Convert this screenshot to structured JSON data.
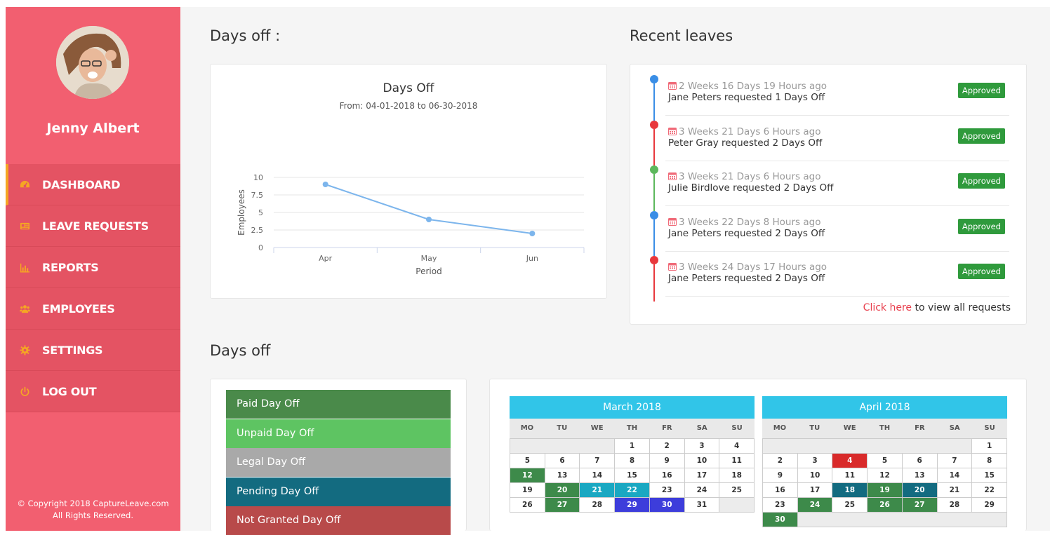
{
  "colors": {
    "sidebar": "#f25f70",
    "accent": "#f5a623",
    "approved": "#2f9a3c",
    "calendar_header": "#31c5e8",
    "chart_line": "#7cb5ec"
  },
  "sidebar": {
    "user_name": "Jenny Albert",
    "items": [
      {
        "label": "DASHBOARD",
        "icon": "dashboard-icon"
      },
      {
        "label": "LEAVE REQUESTS",
        "icon": "id-card-icon"
      },
      {
        "label": "REPORTS",
        "icon": "bar-chart-icon"
      },
      {
        "label": "EMPLOYEES",
        "icon": "users-icon"
      },
      {
        "label": "SETTINGS",
        "icon": "gear-icon"
      },
      {
        "label": "LOG OUT",
        "icon": "power-icon"
      }
    ],
    "copyright_line1": "© Copyright 2018 CaptureLeave.com",
    "copyright_line2": "All Rights Reserved."
  },
  "main": {
    "days_off_heading": "Days off :",
    "recent_heading": "Recent leaves",
    "days_off_heading2": "Days off"
  },
  "chart_data": {
    "type": "line",
    "title": "Days Off",
    "subtitle": "From: 04-01-2018 to 06-30-2018",
    "xlabel": "Period",
    "ylabel": "Employees",
    "categories": [
      "Apr",
      "May",
      "Jun"
    ],
    "yticks": [
      "0",
      "2.5",
      "5",
      "7.5",
      "10"
    ],
    "ylim": [
      0,
      10
    ],
    "values": [
      9,
      4,
      2
    ]
  },
  "recent_leaves": {
    "items": [
      {
        "time": "2 Weeks 16 Days 19 Hours ago",
        "desc": "Jane Peters requested 1 Days Off",
        "status": "Approved",
        "dot_color": "#3a8ee6"
      },
      {
        "time": "3 Weeks 21 Days 6 Hours ago",
        "desc": "Peter Gray requested 2 Days Off",
        "status": "Approved",
        "dot_color": "#e8383d"
      },
      {
        "time": "3 Weeks 21 Days 6 Hours ago",
        "desc": "Julie Birdlove requested 2 Days Off",
        "status": "Approved",
        "dot_color": "#5cb85c"
      },
      {
        "time": "3 Weeks 22 Days 8 Hours ago",
        "desc": "Jane Peters requested 2 Days Off",
        "status": "Approved",
        "dot_color": "#3a8ee6"
      },
      {
        "time": "3 Weeks 24 Days 17 Hours ago",
        "desc": "Jane Peters requested 2 Days Off",
        "status": "Approved",
        "dot_color": "#e8383d"
      }
    ],
    "view_all_link": "Click here",
    "view_all_rest": " to view all requests"
  },
  "legend": [
    {
      "label": "Paid Day Off",
      "color": "#4a8a4a"
    },
    {
      "label": "Unpaid Day Off",
      "color": "#5ec462"
    },
    {
      "label": "Legal Day Off",
      "color": "#a9a9a9"
    },
    {
      "label": "Pending Day Off",
      "color": "#136b80"
    },
    {
      "label": "Not Granted Day Off",
      "color": "#b84a4a"
    }
  ],
  "calendars": [
    {
      "title": "March 2018",
      "weekdays": [
        "MO",
        "TU",
        "WE",
        "TH",
        "FR",
        "SA",
        "SU"
      ],
      "start_offset": 3,
      "days": 31,
      "highlights": {
        "12": "#3d8a4a",
        "20": "#3d8a4a",
        "27": "#3d8a4a",
        "21": "#1aa8c2",
        "22": "#1aa8c2",
        "29": "#3d3ddb",
        "30": "#3d3ddb"
      }
    },
    {
      "title": "April 2018",
      "weekdays": [
        "MO",
        "TU",
        "WE",
        "TH",
        "FR",
        "SA",
        "SU"
      ],
      "start_offset": 6,
      "days": 30,
      "highlights": {
        "4": "#d92a2a",
        "18": "#136b80",
        "19": "#3d8a4a",
        "20": "#136b80",
        "24": "#3d8a4a",
        "26": "#3d8a4a",
        "27": "#3d8a4a",
        "30": "#3d8a4a"
      }
    }
  ]
}
